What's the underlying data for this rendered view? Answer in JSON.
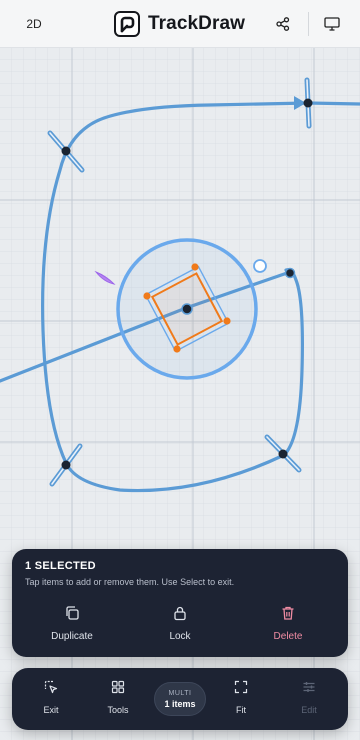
{
  "app": {
    "title": "TrackDraw"
  },
  "toolbar": {
    "mode_label": "2D",
    "share_icon": "share-icon",
    "display_icon": "monitor-icon"
  },
  "canvas": {
    "background": "#e9ecef",
    "track_color": "#5b9bd5",
    "selection_color": "#f07a1a",
    "drone_color": "#b584f0"
  },
  "selection_panel": {
    "title": "1 SELECTED",
    "hint": "Tap items to add or remove them. Use Select to exit.",
    "actions": [
      {
        "label": "Duplicate",
        "icon": "copy-icon"
      },
      {
        "label": "Lock",
        "icon": "lock-icon"
      },
      {
        "label": "Delete",
        "icon": "trash-icon",
        "color": "#f08ca3"
      }
    ]
  },
  "bottom_bar": {
    "exit_label": "Exit",
    "tools_label": "Tools",
    "multi_key": "MULTI",
    "multi_value": "1 items",
    "fit_label": "Fit",
    "edit_label": "Edit"
  }
}
